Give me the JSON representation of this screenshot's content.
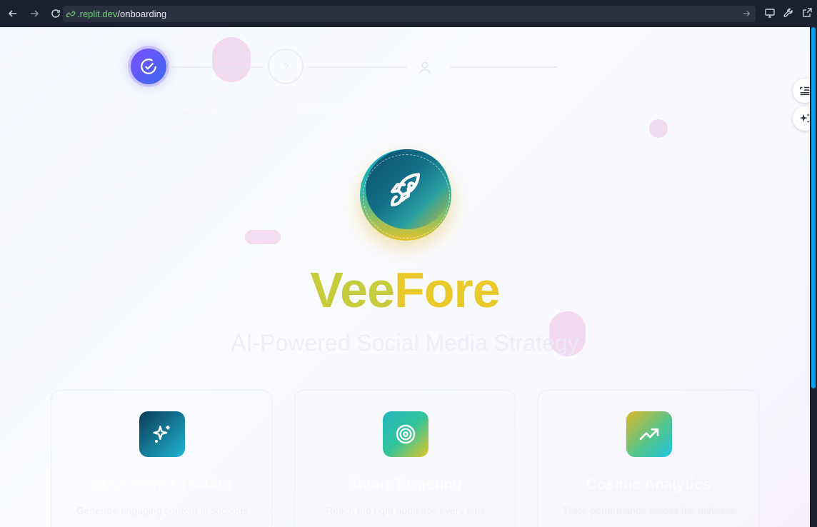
{
  "browser": {
    "url_domain": ".replit.dev",
    "url_path": "/onboarding"
  },
  "stepper": {
    "steps": [
      {
        "label": "Welcome",
        "state": "active"
      },
      {
        "label": "Connect Social",
        "state": "pending"
      },
      {
        "label": "Personalize",
        "state": "pending"
      }
    ]
  },
  "hero": {
    "brand_part1": "Vee",
    "brand_part2": "Fore",
    "tagline": "AI-Powered Social Media Strategy"
  },
  "features": [
    {
      "title": "AI Content Creation",
      "description": "Generate engaging content in seconds",
      "icon": "sparkles-icon"
    },
    {
      "title": "Smart Targeting",
      "description": "Reach the right audience every time",
      "icon": "target-icon"
    },
    {
      "title": "Cosmic Analytics",
      "description": "Track performance across the universe",
      "icon": "trending-up-icon"
    }
  ],
  "colors": {
    "accent_purple": "#7c4dff",
    "brand_yellow": "#d6d13a",
    "teal": "#14708a"
  }
}
